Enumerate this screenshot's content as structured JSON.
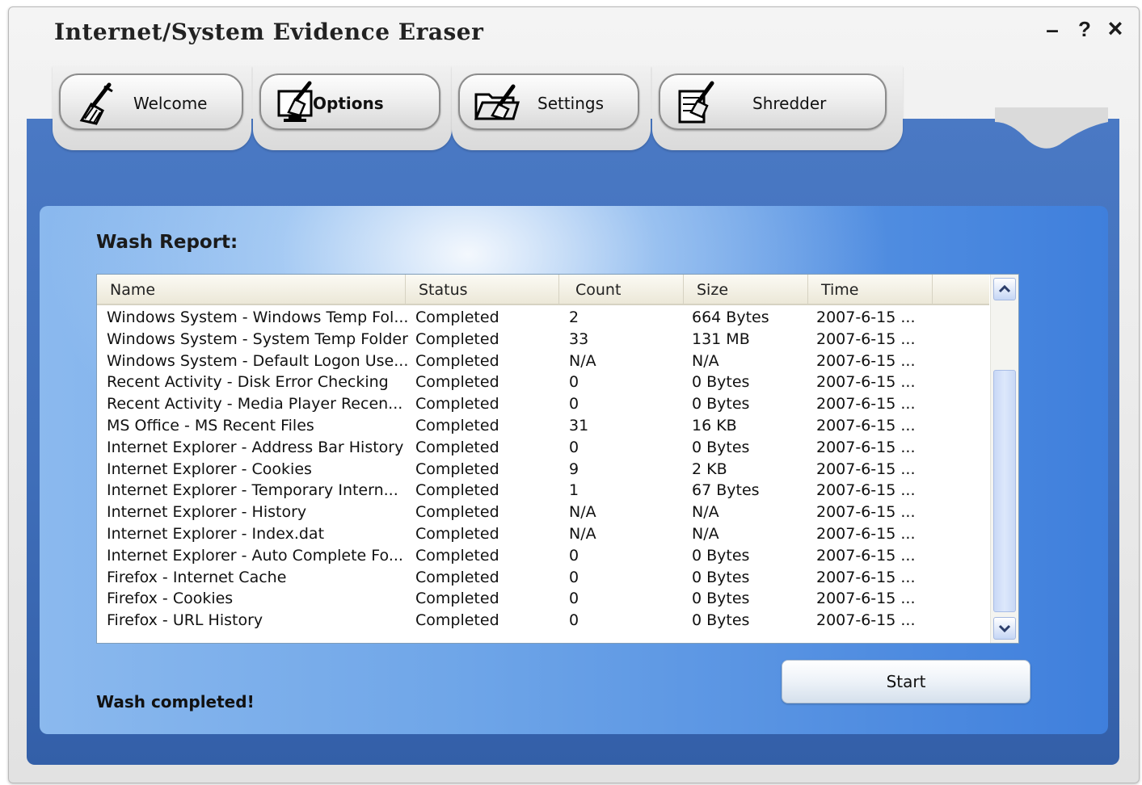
{
  "window": {
    "title": "Internet/System Evidence Eraser",
    "minimize": "–",
    "help": "?",
    "close": "×"
  },
  "tabs": [
    {
      "label": "Welcome",
      "icon": "broom-icon"
    },
    {
      "label": "Options",
      "icon": "monitor-broom-icon"
    },
    {
      "label": "Settings",
      "icon": "folder-broom-icon"
    },
    {
      "label": "Shredder",
      "icon": "document-broom-icon"
    }
  ],
  "report": {
    "title": "Wash Report:",
    "columns": [
      "Name",
      "Status",
      "Count",
      "Size",
      "Time"
    ],
    "rows": [
      [
        "Windows System - Windows Temp Fol...",
        "Completed",
        "2",
        "664 Bytes",
        "2007-6-15 ..."
      ],
      [
        "Windows System - System Temp Folder",
        "Completed",
        "33",
        "131 MB",
        "2007-6-15 ..."
      ],
      [
        "Windows System - Default Logon Use...",
        "Completed",
        "N/A",
        "N/A",
        "2007-6-15 ..."
      ],
      [
        "Recent Activity - Disk Error Checking",
        "Completed",
        "0",
        "0 Bytes",
        "2007-6-15 ..."
      ],
      [
        "Recent Activity - Media Player Recen...",
        "Completed",
        "0",
        "0 Bytes",
        "2007-6-15 ..."
      ],
      [
        "MS Office - MS Recent Files",
        "Completed",
        "31",
        "16 KB",
        "2007-6-15 ..."
      ],
      [
        "Internet Explorer - Address Bar History",
        "Completed",
        "0",
        "0 Bytes",
        "2007-6-15 ..."
      ],
      [
        "Internet Explorer - Cookies",
        "Completed",
        "9",
        "2 KB",
        "2007-6-15 ..."
      ],
      [
        "Internet Explorer - Temporary Intern...",
        "Completed",
        "1",
        "67 Bytes",
        "2007-6-15 ..."
      ],
      [
        "Internet Explorer - History",
        "Completed",
        "N/A",
        "N/A",
        "2007-6-15 ..."
      ],
      [
        "Internet Explorer - Index.dat",
        "Completed",
        "N/A",
        "N/A",
        "2007-6-15 ..."
      ],
      [
        "Internet Explorer - Auto Complete Fo...",
        "Completed",
        "0",
        "0 Bytes",
        "2007-6-15 ..."
      ],
      [
        "Firefox - Internet Cache",
        "Completed",
        "0",
        "0 Bytes",
        "2007-6-15 ..."
      ],
      [
        "Firefox - Cookies",
        "Completed",
        "0",
        "0 Bytes",
        "2007-6-15 ..."
      ],
      [
        "Firefox - URL History",
        "Completed",
        "0",
        "0 Bytes",
        "2007-6-15 ..."
      ]
    ]
  },
  "start_label": "Start",
  "status": "Wash completed!",
  "colors": {
    "frame_blue": "#3f6eb9",
    "panel_light": "#8bb9ee",
    "list_border": "#7f9db9"
  }
}
